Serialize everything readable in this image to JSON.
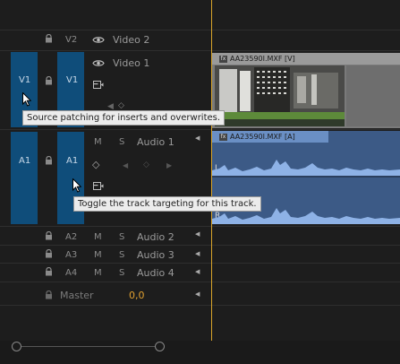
{
  "tracks": {
    "v2": {
      "label": "V2",
      "name": "Video 2"
    },
    "v1": {
      "src": "V1",
      "label": "V1",
      "name": "Video 1"
    },
    "a1": {
      "src": "A1",
      "label": "A1",
      "name": "Audio 1",
      "m": "M",
      "s": "S"
    },
    "a2": {
      "label": "A2",
      "name": "Audio 2",
      "m": "M",
      "s": "S"
    },
    "a3": {
      "label": "A3",
      "name": "Audio 3",
      "m": "M",
      "s": "S"
    },
    "a4": {
      "label": "A4",
      "name": "Audio 4",
      "m": "M",
      "s": "S"
    },
    "master": {
      "name": "Master",
      "value": "0,0"
    }
  },
  "clips": {
    "video": {
      "fx": "fx",
      "name": "AA23590I.MXF [V]"
    },
    "audio": {
      "fx": "fx",
      "name": "AA23590I.MXF [A]",
      "ch_left": "L",
      "ch_right": "R"
    }
  },
  "tooltips": {
    "source_patch": "Source patching for inserts and overwrites.",
    "toggle_target": "Toggle the track targeting for this track."
  },
  "colors": {
    "accent_blue": "#0f4d7a",
    "playhead": "#d9a42a",
    "audio_clip": "#3c5a86",
    "master_value": "#e0a030"
  }
}
